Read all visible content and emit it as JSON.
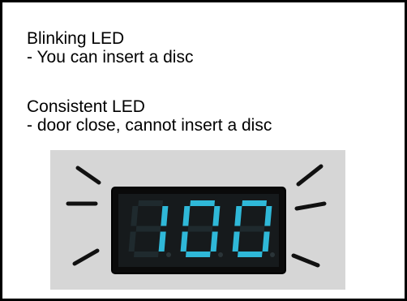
{
  "blinking": {
    "title": "Blinking LED",
    "description": "- You can insert a disc"
  },
  "consistent": {
    "title": "Consistent LED",
    "description": "- door close, cannot insert a disc"
  },
  "display": {
    "digits": "100",
    "digit_color": "#2fb8d8",
    "panel_color": "#0a0a0a",
    "background_color": "#d6d6d6"
  }
}
